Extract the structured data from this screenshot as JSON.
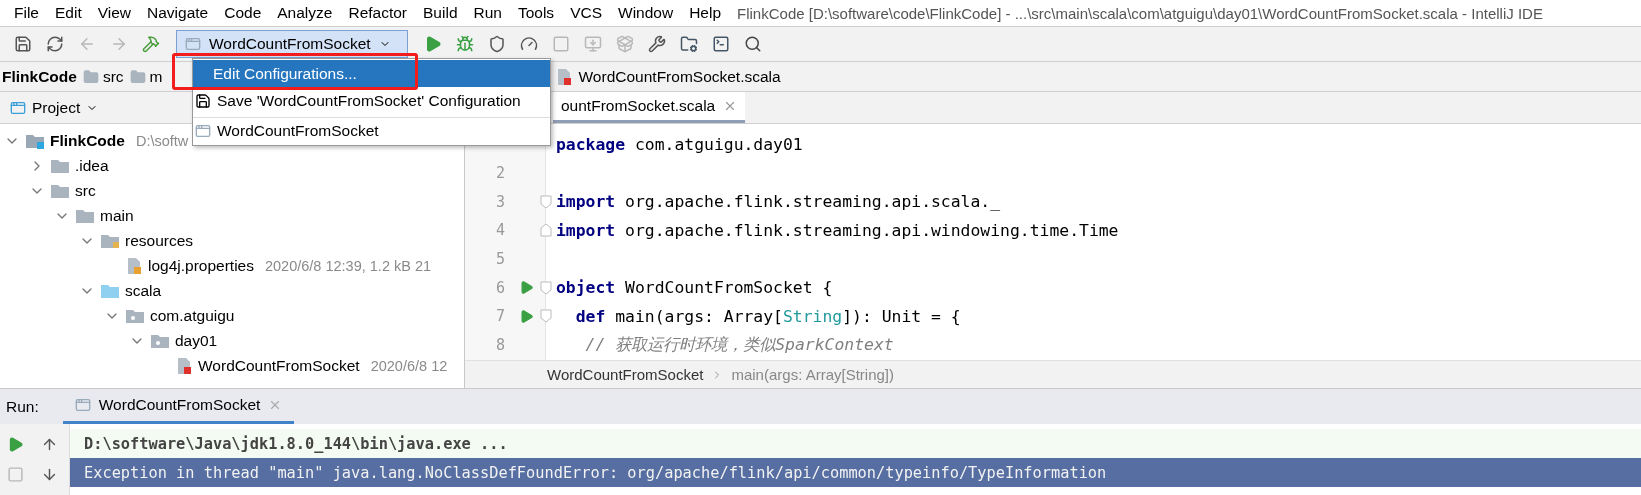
{
  "menubar": {
    "items": [
      "File",
      "Edit",
      "View",
      "Navigate",
      "Code",
      "Analyze",
      "Refactor",
      "Build",
      "Run",
      "Tools",
      "VCS",
      "Window",
      "Help"
    ],
    "title": "FlinkCode [D:\\software\\code\\FlinkCode] - ...\\src\\main\\scala\\com\\atguigu\\day01\\WordCountFromSocket.scala - IntelliJ IDE"
  },
  "toolbar": {
    "left": [
      {
        "kind": "save",
        "disabled": false
      },
      {
        "kind": "sync",
        "disabled": false
      },
      {
        "kind": "back",
        "disabled": true
      },
      {
        "kind": "forward",
        "disabled": true
      },
      {
        "kind": "build",
        "disabled": false
      }
    ],
    "run_config": "WordCountFromSocket",
    "right": [
      {
        "kind": "run",
        "disabled": false
      },
      {
        "kind": "debug",
        "disabled": false
      },
      {
        "kind": "coverage",
        "disabled": false
      },
      {
        "kind": "profile",
        "disabled": false
      },
      {
        "kind": "stop",
        "disabled": true
      },
      {
        "kind": "attach",
        "disabled": true
      },
      {
        "kind": "package",
        "disabled": true
      },
      {
        "kind": "settings",
        "disabled": false
      },
      {
        "kind": "structure",
        "disabled": false
      },
      {
        "kind": "terminal",
        "disabled": false
      },
      {
        "kind": "search",
        "disabled": false
      }
    ]
  },
  "popup": {
    "items": [
      {
        "kind": "action",
        "label": "Edit Configurations...",
        "selected": true,
        "highlight": true
      },
      {
        "kind": "save",
        "label": "Save 'WordCountFromSocket' Configuration",
        "selected": false,
        "highlight": false
      },
      {
        "kind": "config",
        "label": "WordCountFromSocket",
        "selected": false,
        "highlight": false
      }
    ]
  },
  "navbar": {
    "crumbs": [
      {
        "label": "FlinkCode",
        "kind": "project"
      },
      {
        "label": "src",
        "kind": "folder"
      },
      {
        "label": "m",
        "kind": "folder"
      }
    ],
    "file": "WordCountFromSocket.scala"
  },
  "project": {
    "title": "Project",
    "tree": [
      {
        "label": "FlinkCode",
        "kind": "project",
        "expanded": true,
        "note": "D:\\softw",
        "children": [
          {
            "label": ".idea",
            "kind": "folder",
            "expanded": false
          },
          {
            "label": "src",
            "kind": "folder",
            "expanded": true,
            "children": [
              {
                "label": "main",
                "kind": "folder",
                "expanded": true,
                "children": [
                  {
                    "label": "resources",
                    "kind": "resources",
                    "expanded": true,
                    "children": [
                      {
                        "label": "log4j.properties",
                        "kind": "properties",
                        "note": "2020/6/8 12:39, 1.2 kB 21"
                      }
                    ]
                  },
                  {
                    "label": "scala",
                    "kind": "source",
                    "expanded": true,
                    "children": [
                      {
                        "label": "com.atguigu",
                        "kind": "package",
                        "expanded": true,
                        "children": [
                          {
                            "label": "day01",
                            "kind": "package",
                            "expanded": true,
                            "children": [
                              {
                                "label": "WordCountFromSocket",
                                "kind": "scala",
                                "note": "2020/6/8 12"
                              }
                            ]
                          }
                        ]
                      }
                    ]
                  }
                ]
              }
            ]
          }
        ]
      }
    ]
  },
  "editor": {
    "tab": {
      "label": "ountFromSocket.scala",
      "selected": true
    },
    "lines": [
      {
        "run": false,
        "fold_start": false,
        "fold_end": false,
        "tokens": [
          {
            "kind": "keyword",
            "text": "package"
          },
          {
            "kind": "plain",
            "text": " com.atguigu.day01"
          }
        ]
      },
      {
        "number": "2",
        "run": false,
        "fold_start": false,
        "fold_end": false
      },
      {
        "number": "3",
        "run": false,
        "fold_start": true,
        "fold_end": false,
        "tokens": [
          {
            "kind": "keyword",
            "text": "import"
          },
          {
            "kind": "plain",
            "text": " org.apache.flink.streaming.api.scala._"
          }
        ]
      },
      {
        "number": "4",
        "run": false,
        "fold_start": false,
        "fold_end": true,
        "tokens": [
          {
            "kind": "keyword",
            "text": "import"
          },
          {
            "kind": "plain",
            "text": " org.apache.flink.streaming.api.windowing.time.Time"
          }
        ]
      },
      {
        "number": "5",
        "run": false,
        "fold_start": false,
        "fold_end": false
      },
      {
        "number": "6",
        "run": true,
        "fold_start": true,
        "fold_end": false,
        "tokens": [
          {
            "kind": "keyword",
            "text": "object"
          },
          {
            "kind": "plain",
            "text": " WordCountFromSocket {"
          }
        ]
      },
      {
        "number": "7",
        "run": true,
        "fold_start": true,
        "fold_end": false,
        "tokens": [
          {
            "kind": "keyword",
            "text": "  def"
          },
          {
            "kind": "plain",
            "text": " main(args: Array["
          },
          {
            "kind": "type",
            "text": "String"
          },
          {
            "kind": "plain",
            "text": "]): Unit = {"
          }
        ]
      },
      {
        "number": "8",
        "run": false,
        "fold_start": false,
        "fold_end": false,
        "tokens": [
          {
            "kind": "comment",
            "text": "   // 获取运行时环境，类似SparkContext"
          }
        ]
      }
    ],
    "breadcrumbs": [
      "WordCountFromSocket",
      "main(args: Array[String])"
    ]
  },
  "run_panel": {
    "label": "Run:",
    "tab": {
      "label": "WordCountFromSocket",
      "selected": true
    },
    "buttons": [
      {
        "kind": "rerun",
        "disabled": false
      },
      {
        "kind": "up",
        "disabled": false
      },
      {
        "kind": "stop",
        "disabled": true
      },
      {
        "kind": "down",
        "disabled": false
      }
    ],
    "console": [
      {
        "kind": "command",
        "text": "D:\\software\\Java\\jdk1.8.0_144\\bin\\java.exe ...",
        "selected": false
      },
      {
        "kind": "error",
        "text": "Exception in thread \"main\" java.lang.NoClassDefFoundError: org/apache/flink/api/common/typeinfo/TypeInformation",
        "selected": true
      }
    ]
  }
}
